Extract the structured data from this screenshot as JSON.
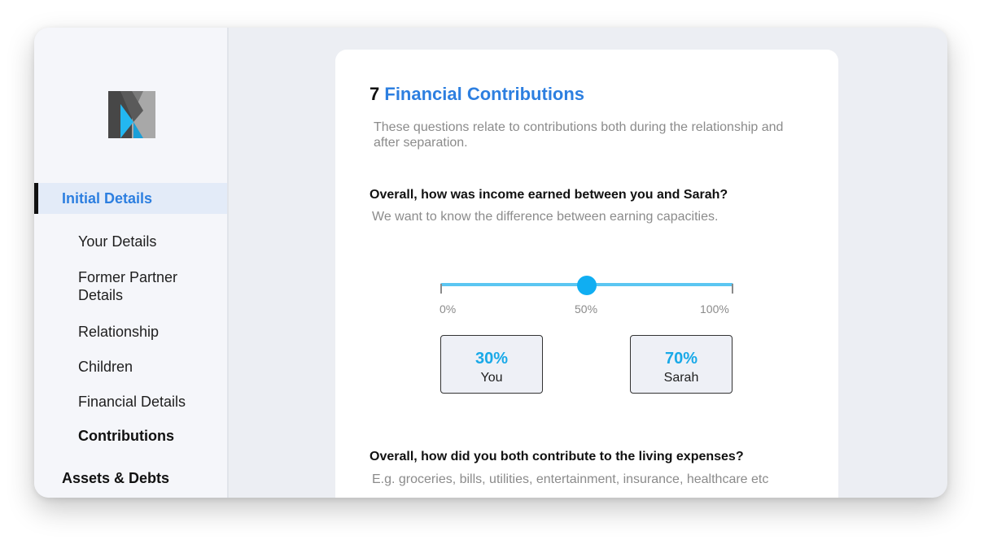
{
  "sidebar": {
    "section_label": "Initial Details",
    "items": [
      {
        "label": "Your Details"
      },
      {
        "label": "Former Partner Details"
      },
      {
        "label": "Relationship"
      },
      {
        "label": "Children"
      },
      {
        "label": "Financial Details"
      },
      {
        "label": "Contributions"
      }
    ],
    "next_section_label": "Assets & Debts"
  },
  "main": {
    "step_number": "7",
    "step_title": "Financial Contributions",
    "intro": "These questions relate to contributions both during the relationship and after separation.",
    "question1": {
      "title": "Overall, how was income earned between you and Sarah?",
      "hint": "We want to know the difference between earning capacities.",
      "slider": {
        "value_fraction": 0.5,
        "labels": {
          "min": "0%",
          "mid": "50%",
          "max": "100%"
        }
      },
      "you": {
        "percent": "30%",
        "label": "You"
      },
      "partner": {
        "percent": "70%",
        "label": "Sarah"
      }
    },
    "question2": {
      "title": "Overall, how did you both contribute to the living expenses?",
      "hint": "E.g. groceries, bills, utilities, entertainment, insurance, healthcare etc"
    }
  },
  "colors": {
    "accent_blue": "#2d7fe0",
    "slider_blue": "#10aef2",
    "percent_blue": "#19a9e8"
  }
}
